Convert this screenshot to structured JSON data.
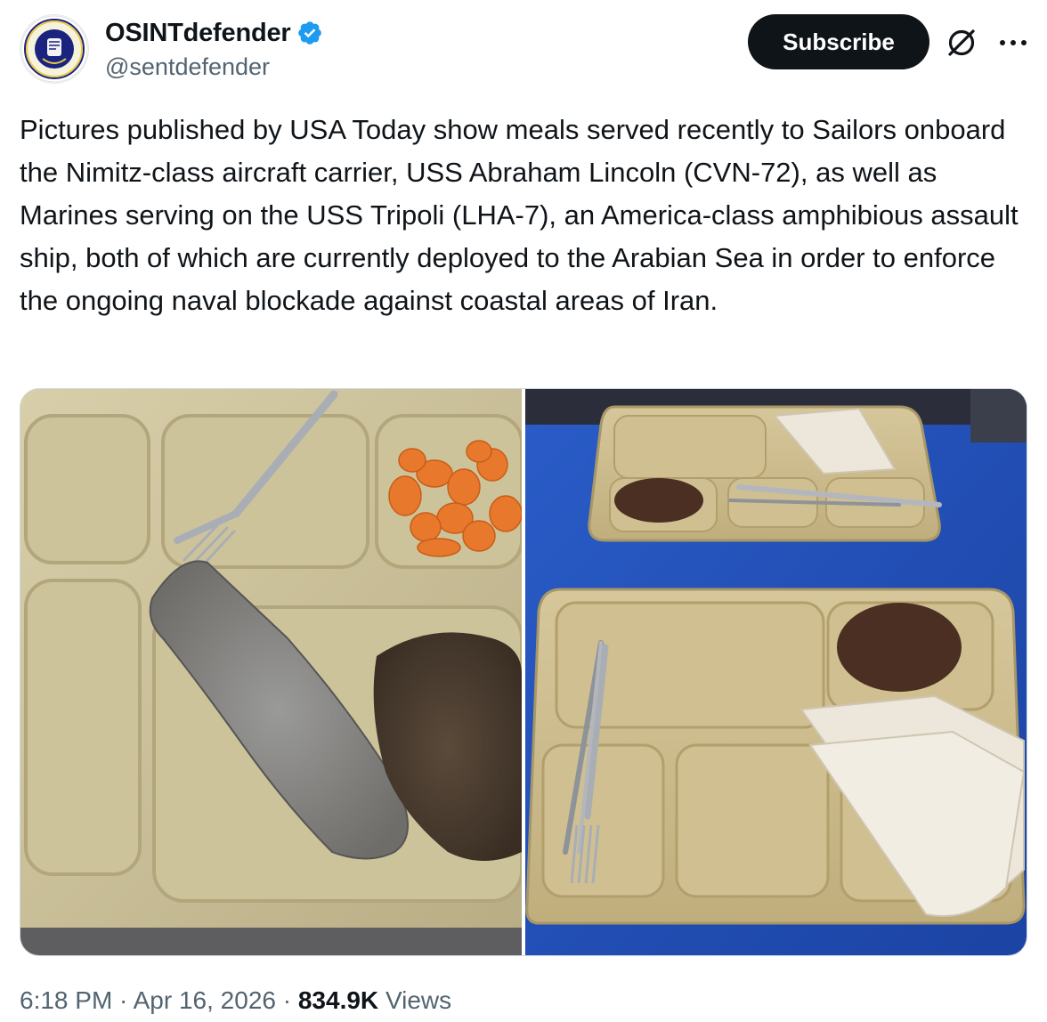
{
  "author": {
    "display_name": "OSINTdefender",
    "handle": "@sentdefender",
    "verified": true,
    "verified_color": "#1d9bf0"
  },
  "actions": {
    "subscribe_label": "Subscribe",
    "grok_icon": "grok-icon",
    "more_icon": "more-icon"
  },
  "tweet": {
    "text": "Pictures published by USA Today show meals served recently to Sailors onboard the Nimitz-class aircraft carrier, USS Abraham Lincoln (CVN-72), as well as Marines serving on the USS Tripoli (LHA-7), an America-class amphibious assault ship, both of which are currently deployed to the Arabian Sea in order to enforce the ongoing naval blockade against coastal areas of Iran."
  },
  "media": {
    "photos": [
      {
        "subject": "tray with carrots, bread slice and meat patty"
      },
      {
        "subject": "two trays with shredded beef and tortillas on blue table"
      }
    ]
  },
  "footer": {
    "time": "6:18 PM",
    "separator": " · ",
    "date": "Apr 16, 2026",
    "views_count": "834.9K",
    "views_label": "Views"
  },
  "colors": {
    "text_primary": "#0f1419",
    "text_secondary": "#536471",
    "button_bg": "#0f1419",
    "table_blue": "#1f4fb8",
    "tray_tan": "#c8b98c"
  }
}
